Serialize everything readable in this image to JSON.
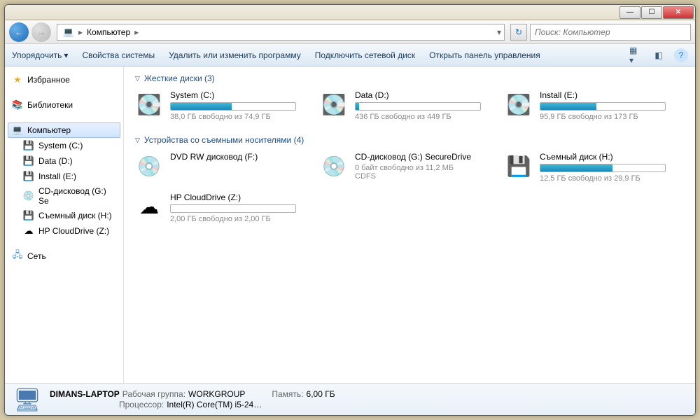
{
  "titlebar": {
    "min": "—",
    "max": "☐",
    "close": "✕"
  },
  "nav": {
    "back": "←",
    "fwd": "→",
    "refresh": "↻"
  },
  "breadcrumb": {
    "root_icon": "💻",
    "root": "Компьютер",
    "dd": "▾"
  },
  "search": {
    "placeholder": "Поиск: Компьютер"
  },
  "toolbar": {
    "organize": "Упорядочить",
    "properties": "Свойства системы",
    "uninstall": "Удалить или изменить программу",
    "mapnet": "Подключить сетевой диск",
    "controlpanel": "Открыть панель управления"
  },
  "sidebar": {
    "favorites": "Избранное",
    "libraries": "Библиотеки",
    "computer": "Компьютер",
    "network": "Сеть",
    "drives": [
      {
        "icon": "💾",
        "label": "System (C:)"
      },
      {
        "icon": "💾",
        "label": "Data (D:)"
      },
      {
        "icon": "💾",
        "label": "Install (E:)"
      },
      {
        "icon": "💿",
        "label": "CD-дисковод (G:) Se"
      },
      {
        "icon": "💾",
        "label": "Съемный диск (H:)"
      },
      {
        "icon": "☁",
        "label": "HP CloudDrive (Z:)"
      }
    ]
  },
  "sections": {
    "hdd": {
      "label": "Жесткие диски (3)"
    },
    "removable": {
      "label": "Устройства со съемными носителями (4)"
    }
  },
  "hdd_drives": [
    {
      "icon": "💽",
      "name": "System (C:)",
      "space": "38,0 ГБ свободно из 74,9 ГБ",
      "fill": 49
    },
    {
      "icon": "💽",
      "name": "Data (D:)",
      "space": "436 ГБ свободно из 449 ГБ",
      "fill": 3
    },
    {
      "icon": "💽",
      "name": "Install (E:)",
      "space": "95,9 ГБ свободно из 173 ГБ",
      "fill": 45
    }
  ],
  "rem_drives": [
    {
      "icon": "💿",
      "name": "DVD RW дисковод (F:)",
      "space": "",
      "nobar": true
    },
    {
      "icon": "💿",
      "name": "CD-дисковод (G:) SecureDrive",
      "space": "0 байт свободно из 11,2 МБ",
      "extra": "CDFS",
      "nobar": true
    },
    {
      "icon": "💾",
      "name": "Съемный диск (H:)",
      "space": "12,5 ГБ свободно из 29,9 ГБ",
      "fill": 58
    },
    {
      "icon": "☁",
      "name": "HP CloudDrive (Z:)",
      "space": "2,00 ГБ свободно из 2,00 ГБ",
      "fill": 0
    }
  ],
  "status": {
    "name": "DIMANS-LAPTOP",
    "wg_label": "Рабочая группа:",
    "wg": "WORKGROUP",
    "mem_label": "Память:",
    "mem": "6,00 ГБ",
    "cpu_label": "Процессор:",
    "cpu": "Intel(R) Core(TM) i5-24…"
  }
}
